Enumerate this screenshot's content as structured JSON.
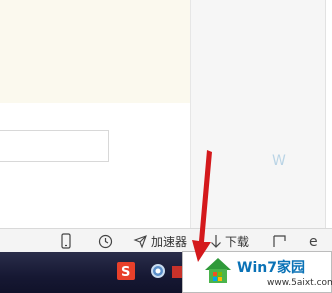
{
  "status_bar": {
    "accelerator_label": "加速器",
    "download_label": "下载"
  },
  "watermark": {
    "brand_name": "Win7家园",
    "url": "www.5aixt.com"
  },
  "colors": {
    "arrow": "#d4191c",
    "brand_blue": "#0a72b6",
    "taskbar": "#161833"
  },
  "icons": [
    "mobile-icon",
    "clock-icon",
    "rocket-icon",
    "download-arrow-icon",
    "screenshot-icon",
    "ie-icon",
    "sogou-input-icon",
    "gear-tray-icon",
    "red-arrow-icon",
    "win7-house-logo"
  ]
}
